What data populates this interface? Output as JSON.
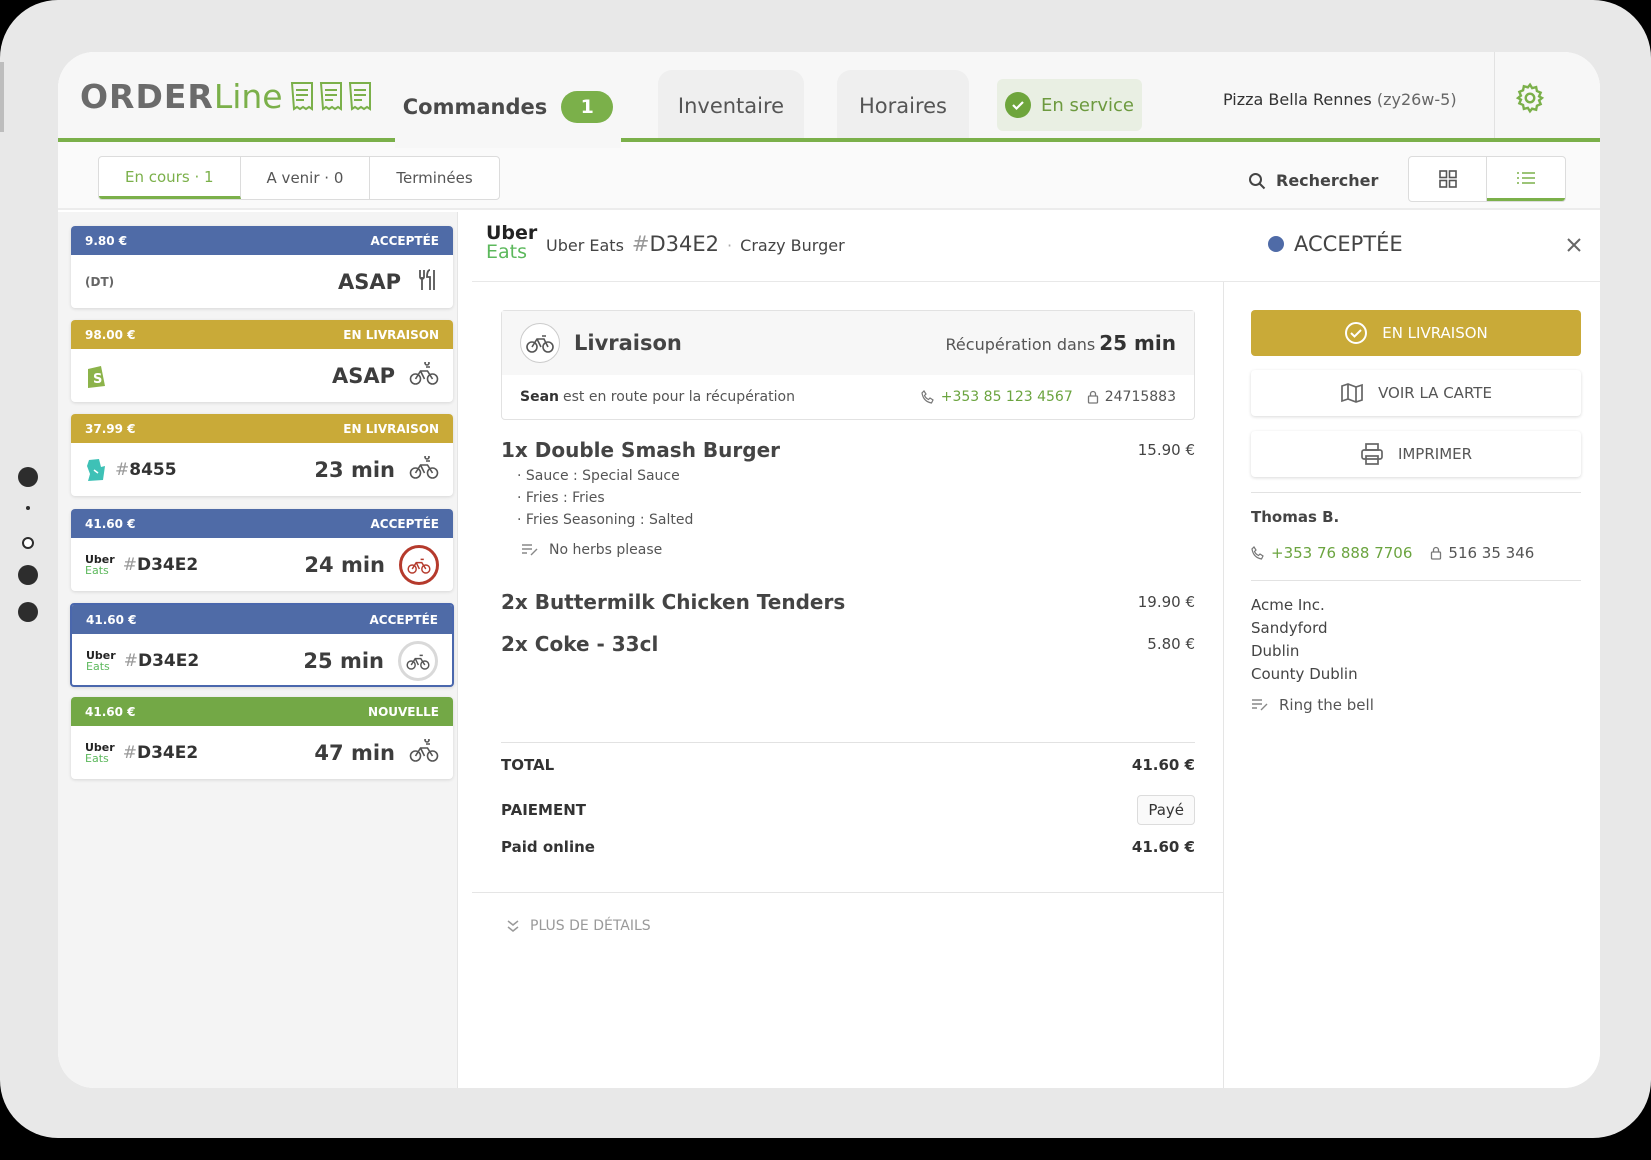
{
  "app": {
    "logo_order": "ORDER",
    "logo_line": "Line",
    "tabs": [
      {
        "label": "Commandes",
        "count": "1"
      },
      {
        "label": "Inventaire"
      },
      {
        "label": "Horaires"
      }
    ],
    "service_label": "En service",
    "restaurant_name": "Pizza Bella Rennes",
    "restaurant_code": "(zy26w-5)"
  },
  "subbar": {
    "filters": [
      {
        "label": "En cours",
        "count": "1"
      },
      {
        "label": "A venir",
        "count": "0"
      },
      {
        "label": "Terminées"
      }
    ],
    "search_label": "Rechercher"
  },
  "orders": [
    {
      "amount": "9.80 €",
      "status": "ACCEPTÉE",
      "color": "#4f6ba7",
      "source": "(DT)",
      "ref": "",
      "time": "ASAP",
      "icon": "fork-knife-icon"
    },
    {
      "amount": "98.00 €",
      "status": "EN LIVRAISON",
      "color": "#c9aa38",
      "source": "shopify",
      "ref": "",
      "time": "ASAP",
      "icon": "bike-icon"
    },
    {
      "amount": "37.99 €",
      "status": "EN LIVRAISON",
      "color": "#c9aa38",
      "source": "deliveroo",
      "ref": "8455",
      "time": "23 min",
      "icon": "bike-icon"
    },
    {
      "amount": "41.60 €",
      "status": "ACCEPTÉE",
      "color": "#4f6ba7",
      "source": "ubereats",
      "ref": "D34E2",
      "time": "24 min",
      "icon": "bike-ring-red-icon"
    },
    {
      "amount": "41.60 €",
      "status": "ACCEPTÉE",
      "color": "#4f6ba7",
      "source": "ubereats",
      "ref": "D34E2",
      "time": "25 min",
      "icon": "bike-ring-grey-icon"
    },
    {
      "amount": "41.60 €",
      "status": "NOUVELLE",
      "color": "#73a846",
      "source": "ubereats",
      "ref": "D34E2",
      "time": "47 min",
      "icon": "bike-icon"
    }
  ],
  "uber_logo": {
    "top": "Uber",
    "bottom": "Eats"
  },
  "detail": {
    "platform": "Uber Eats",
    "order_ref": "D34E2",
    "hash": "#",
    "brand": "Crazy Burger",
    "status": "ACCEPTÉE",
    "delivery": {
      "title": "Livraison",
      "pickup_label": "Récupération dans",
      "pickup_time": "25 min",
      "courier": "Sean",
      "courier_text": "est en route pour la récupération",
      "phone": "+353 85 123 4567",
      "code": "24715883"
    },
    "items": [
      {
        "qty_name": "1x Double Smash Burger",
        "price": "15.90 €",
        "options": [
          "Sauce : Special Sauce",
          "Fries : Fries",
          "Fries Seasoning : Salted"
        ],
        "note": "No herbs please"
      },
      {
        "qty_name": "2x Buttermilk Chicken Tenders",
        "price": "19.90 €"
      },
      {
        "qty_name": "2x Coke - 33cl",
        "price": "5.80 €"
      }
    ],
    "total_label": "TOTAL",
    "total": "41.60 €",
    "payment_label": "PAIEMENT",
    "payment_status": "Payé",
    "paid_online_label": "Paid online",
    "paid_online": "41.60 €",
    "more_label": "PLUS DE DÉTAILS"
  },
  "actions": {
    "deliver": "EN LIVRAISON",
    "map": "VOIR LA CARTE",
    "print": "IMPRIMER"
  },
  "customer": {
    "name": "Thomas B.",
    "phone": "+353 76 888 7706",
    "code": "516 35 346",
    "address": [
      "Acme Inc.",
      "Sandyford",
      "Dublin",
      "County Dublin"
    ],
    "note": "Ring the bell"
  },
  "colors": {
    "accent_green": "#7bb04a",
    "accepted_blue": "#4f6ba7",
    "delivery_yellow": "#c9aa38",
    "new_green": "#73a846"
  }
}
